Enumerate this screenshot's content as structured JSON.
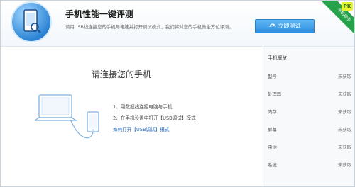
{
  "header": {
    "title": "手机性能一键评测",
    "description": "请用USB线连接您的手机与电脑并打开调试模式，我们将对您的手机做全方位评测。",
    "test_button": "立即测试",
    "corner_badge": "手机助手",
    "pk_tag": "PK"
  },
  "main": {
    "prompt": "请连接您的手机",
    "steps": [
      "1、用数据线连接电脑与手机",
      "2、在手机设置中打开【USB调试】模式"
    ],
    "help_link": "如何打开【USB调试】模式"
  },
  "sidebar": {
    "title": "手机概览",
    "rows": [
      {
        "label": "型号",
        "value": "未获取"
      },
      {
        "label": "处理器",
        "value": "未获取"
      },
      {
        "label": "内存",
        "value": "未获取"
      },
      {
        "label": "屏幕",
        "value": "未获取"
      },
      {
        "label": "电池",
        "value": "未获取"
      },
      {
        "label": "系统",
        "value": "未获取"
      }
    ]
  },
  "colors": {
    "accent": "#2f8fe0",
    "link": "#2a6fc4",
    "badge": "#26a34a"
  }
}
